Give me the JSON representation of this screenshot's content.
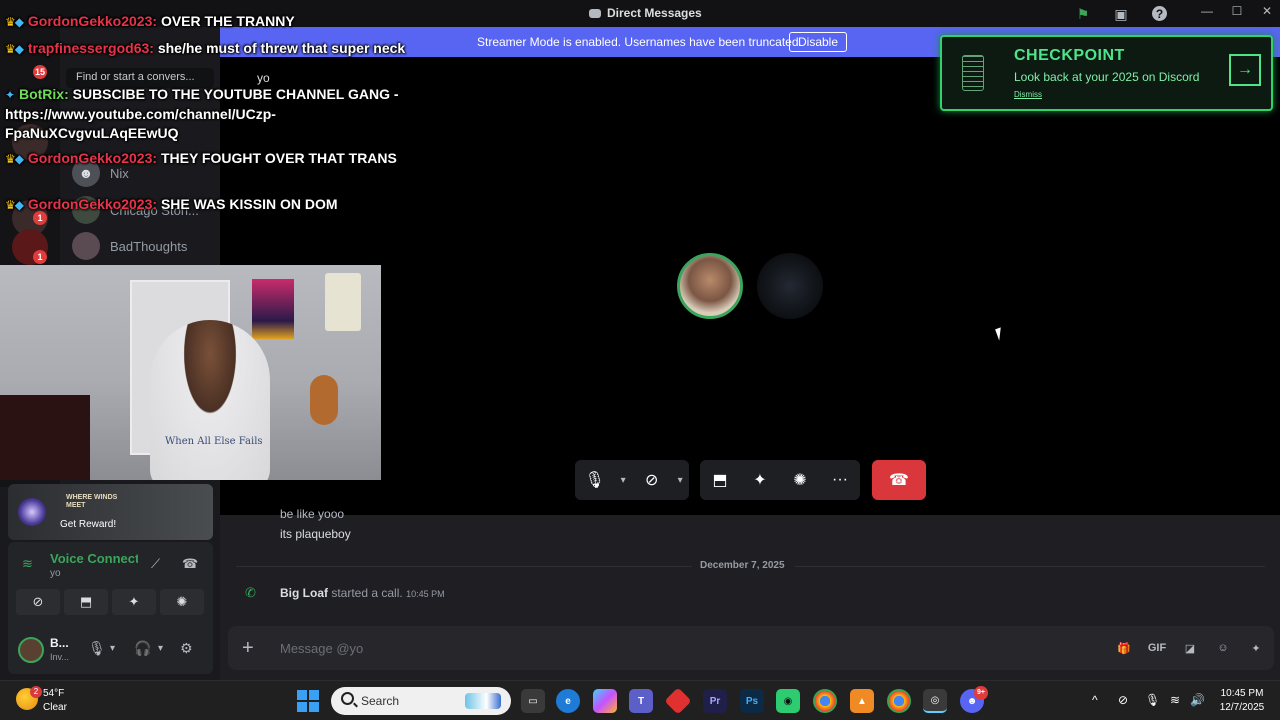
{
  "window": {
    "title": "Direct Messages"
  },
  "banner": {
    "text": "Streamer Mode is enabled. Usernames have been truncated.",
    "button": "Disable"
  },
  "sidebar": {
    "search_placeholder": "Find or start a convers...",
    "dm_items": [
      {
        "name": "Nix"
      },
      {
        "name": "Chicago Stori..."
      },
      {
        "name": "BadThoughts"
      }
    ],
    "server_badges": [
      "15",
      "1",
      "1"
    ]
  },
  "call": {
    "header_user": "yo"
  },
  "checkpoint": {
    "title": "CHECKPOINT",
    "subtitle": "Look back at your 2025 on Discord",
    "dismiss": "Dismiss"
  },
  "chat": {
    "messages": [
      {
        "text": "be like yooo"
      },
      {
        "text": "its plaqueboy"
      }
    ],
    "date_divider": "December 7, 2025",
    "system": {
      "user": "Big Loaf",
      "action": "started a call.",
      "time": "10:45 PM"
    },
    "input_placeholder": "Message @yo",
    "input_icons": [
      "gift-icon",
      "GIF",
      "sticker-icon",
      "emoji-icon",
      "apps-icon"
    ]
  },
  "promo": {
    "game": "WHERE WINDS MEET",
    "cta": "Get Reward!"
  },
  "voice": {
    "status": "Voice Connected",
    "channel": "yo"
  },
  "user": {
    "name": "B...",
    "status": "Inv..."
  },
  "stream_chat": [
    {
      "user": "GordonGekko2023:",
      "text": "OVER THE TRANNY"
    },
    {
      "user": "trapfinessergod63:",
      "text": "she/he must of threw that super neck"
    },
    {
      "user": "BotRix:",
      "text": "SUBSCIBE TO THE YOUTUBE CHANNEL GANG - https://www.youtube.com/channel/UCzp-FpaNuXCvgvuLAqEEwUQ"
    },
    {
      "user": "GordonGekko2023:",
      "text": "THEY FOUGHT OVER THAT TRANS"
    },
    {
      "user": "GordonGekko2023:",
      "text": "SHE WAS KISSIN ON DOM"
    }
  ],
  "webcam": {
    "shirt_text": "When All Else Fails"
  },
  "taskbar": {
    "weather_temp": "54°F",
    "weather_cond": "Clear",
    "weather_badge": "2",
    "search": "Search",
    "time": "10:45 PM",
    "date": "12/7/2025",
    "discord_badge": "9+"
  },
  "colors": {
    "accent": "#5865f2",
    "hangup": "#da373c",
    "online": "#3ba55c",
    "checkpoint": "#4fe38a"
  }
}
